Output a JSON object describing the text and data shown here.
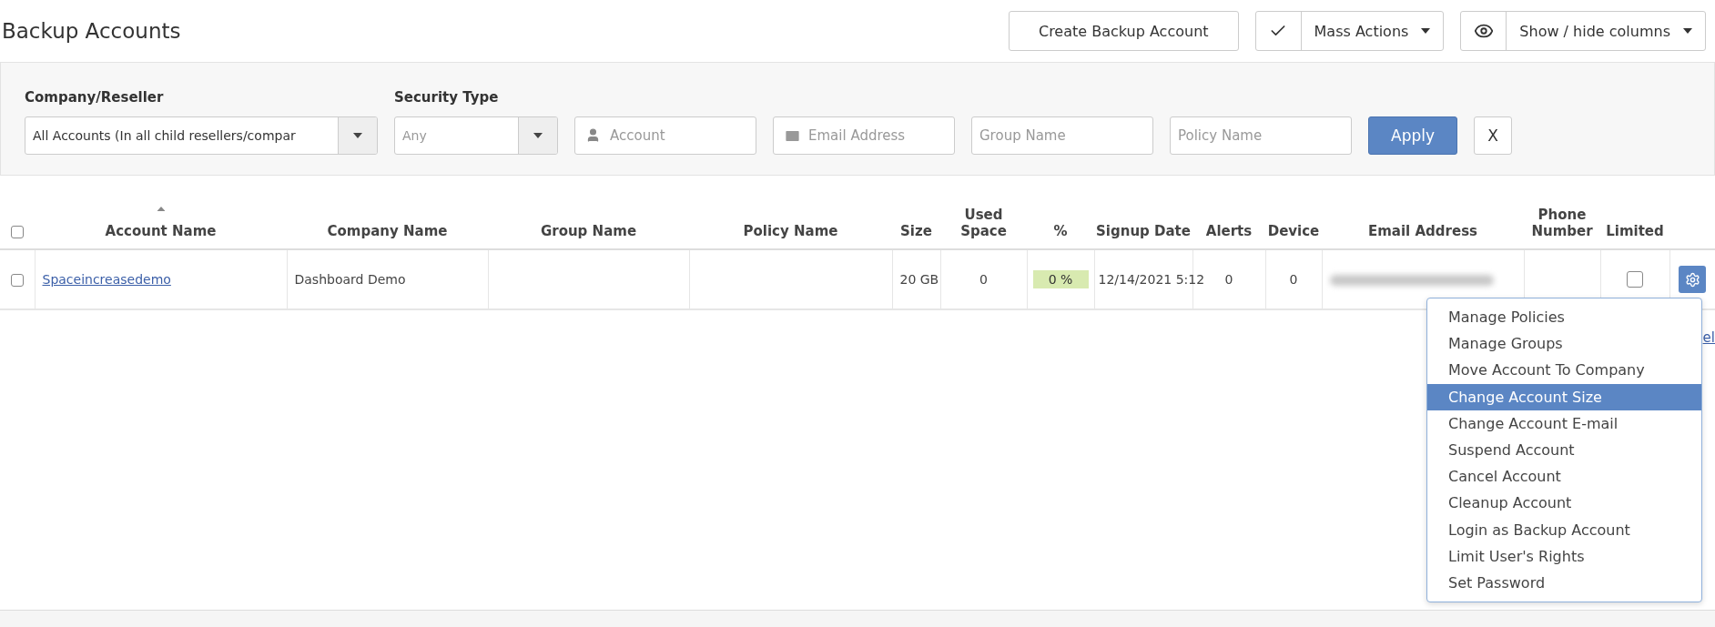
{
  "page_title": "Backup Accounts",
  "toolbar": [
    {
      "kind": "plain",
      "label": "Create Backup Account"
    },
    {
      "kind": "check-menu",
      "label": "Mass Actions"
    },
    {
      "kind": "eye-menu",
      "label": "Show / hide columns"
    }
  ],
  "filters": [
    {
      "kind": "select",
      "label": "Company/Reseller",
      "value": "All Accounts (In all child resellers/compar"
    },
    {
      "kind": "select",
      "label": "Security Type",
      "placeholder": "Any"
    },
    {
      "kind": "user-field",
      "placeholder": "Account"
    },
    {
      "kind": "mail-field",
      "placeholder": "Email Address"
    },
    {
      "kind": "field",
      "placeholder": "Group Name"
    },
    {
      "kind": "field",
      "placeholder": "Policy Name"
    }
  ],
  "apply_button": "Apply",
  "clear_button": "X",
  "table": {
    "select_all": false,
    "columns": [
      {
        "label": "Account Name",
        "sorted": true
      },
      {
        "label": "Company Name",
        "sorted": false
      },
      {
        "label": "Group Name",
        "sorted": false
      },
      {
        "label": "Policy Name",
        "sorted": false
      },
      {
        "label": "Size",
        "sorted": false
      },
      {
        "label": "Used Space",
        "sorted": false
      },
      {
        "label": "%",
        "sorted": false
      },
      {
        "label": "Signup Date",
        "sorted": false
      },
      {
        "label": "Alerts",
        "sorted": false
      },
      {
        "label": "Device",
        "sorted": false
      },
      {
        "label": "Email Address",
        "sorted": false
      },
      {
        "label": "Phone Number",
        "sorted": false
      },
      {
        "label": "Limited",
        "sorted": false
      }
    ],
    "rows": [
      {
        "selected": false,
        "account": "Spaceincreasedemo",
        "company": "Dashboard Demo",
        "size": "20 GB",
        "used_space": "0",
        "percent": "0 %",
        "signup_date": "12/14/2021 5:12",
        "alerts": "0",
        "device": "0",
        "limited": false
      }
    ]
  },
  "partial_link": "el",
  "action_menu": [
    {
      "label": "Manage Policies",
      "selected": false
    },
    {
      "label": "Manage Groups",
      "selected": false
    },
    {
      "label": "Move Account To Company",
      "selected": false
    },
    {
      "label": "Change Account Size",
      "selected": true
    },
    {
      "label": "Change Account E-mail",
      "selected": false
    },
    {
      "label": "Suspend Account",
      "selected": false
    },
    {
      "label": "Cancel Account",
      "selected": false
    },
    {
      "label": "Cleanup Account",
      "selected": false
    },
    {
      "label": "Login as Backup Account",
      "selected": false
    },
    {
      "label": "Limit User's Rights",
      "selected": false
    },
    {
      "label": "Set Password",
      "selected": false
    }
  ]
}
